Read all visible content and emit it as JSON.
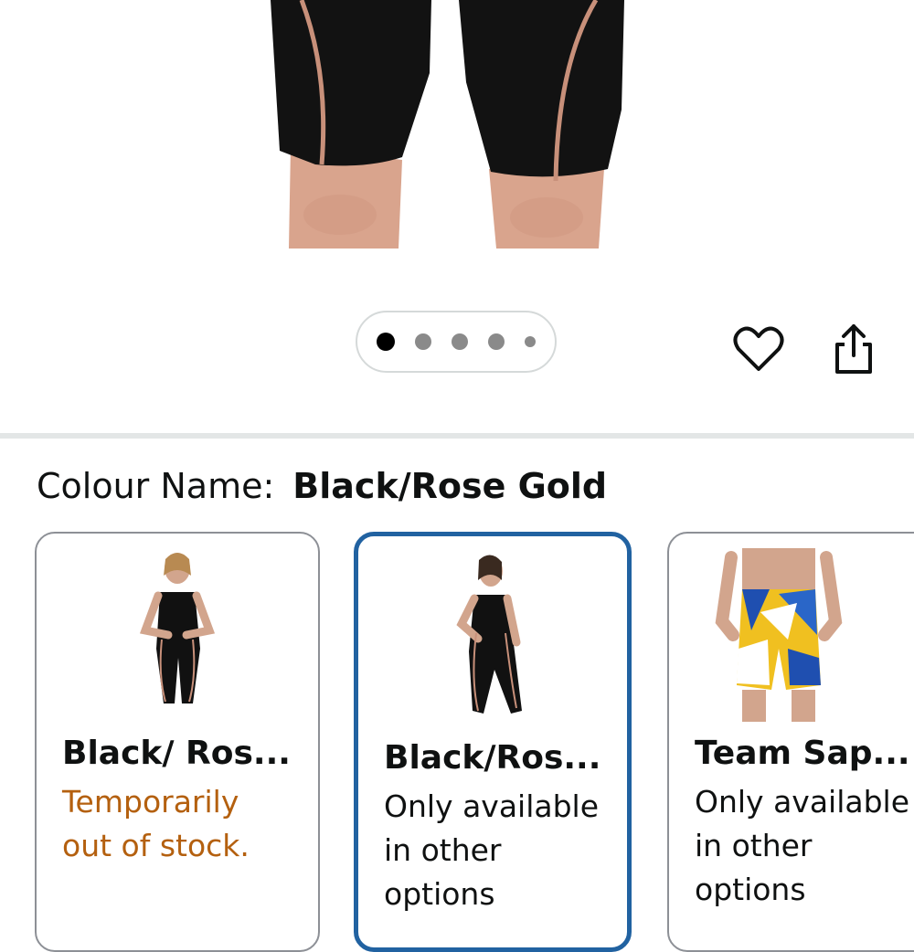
{
  "gallery": {
    "total_images": 5,
    "active_index": 0
  },
  "actions": {
    "wishlist_icon": "heart-outline-icon",
    "share_icon": "share-icon"
  },
  "colour": {
    "label": "Colour Name:",
    "value": "Black/Rose Gold"
  },
  "variants": [
    {
      "title": "Black/ Ros...",
      "status_lines": [
        "Temporarily",
        "out of stock."
      ],
      "status_type": "out_of_stock",
      "selected": false
    },
    {
      "title": "Black/Ros...",
      "status_lines": [
        "Only available",
        "in other",
        "options"
      ],
      "status_type": "other_options",
      "selected": true
    },
    {
      "title": "Team Sap...",
      "status_lines": [
        "Only available",
        "in other",
        "options"
      ],
      "status_type": "other_options",
      "selected": false
    }
  ],
  "colors": {
    "accent_selected_border": "#2162a1",
    "out_of_stock_text": "#b4600f",
    "suit_black": "#111111",
    "rose_gold_stripe": "#c8907a"
  }
}
